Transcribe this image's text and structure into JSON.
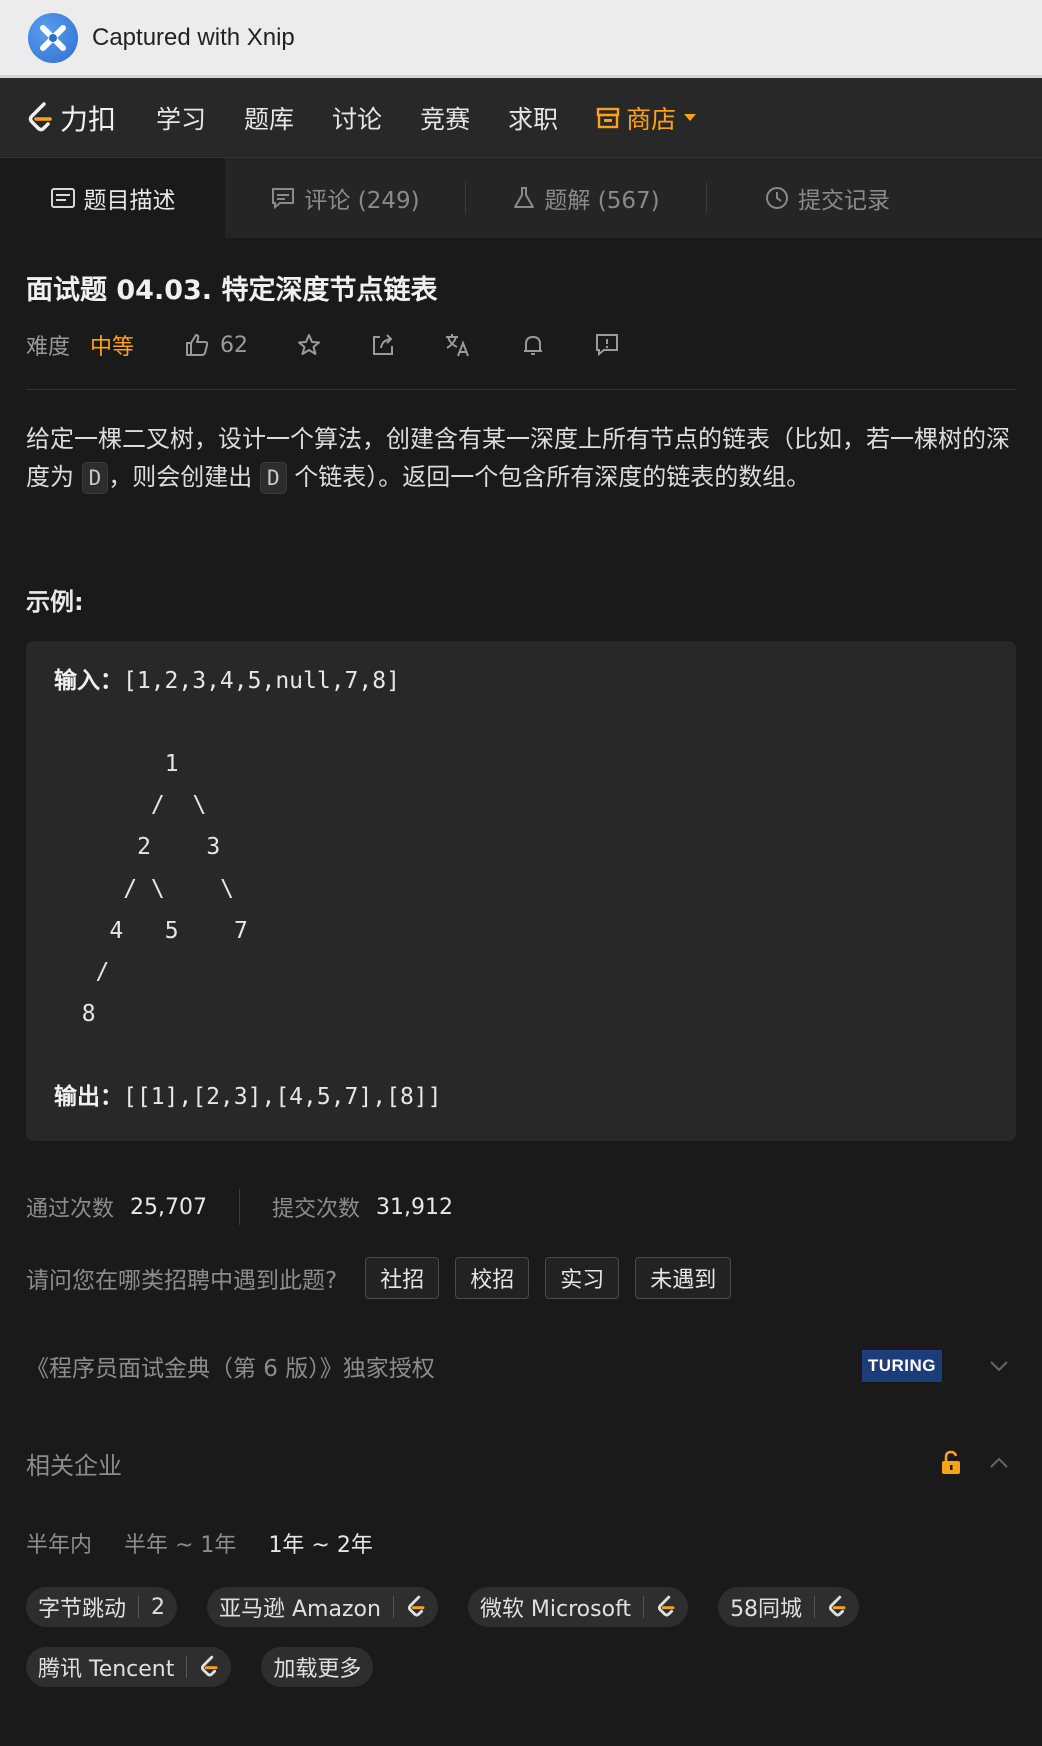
{
  "xnip": {
    "title": "Captured with Xnip"
  },
  "nav": {
    "brand": "力扣",
    "items": [
      "学习",
      "题库",
      "讨论",
      "竞赛",
      "求职"
    ],
    "store": "商店"
  },
  "tabs": {
    "description": "题目描述",
    "comments": "评论 (249)",
    "solutions": "题解 (567)",
    "submissions": "提交记录"
  },
  "problem": {
    "title": "面试题 04.03. 特定深度节点链表",
    "difficulty_label": "难度",
    "difficulty": "中等",
    "likes": "62",
    "desc_part1": "给定一棵二叉树，设计一个算法，创建含有某一深度上所有节点的链表（比如，若一棵树的深度为",
    "desc_code1": "D",
    "desc_part2": "，则会创建出",
    "desc_code2": "D",
    "desc_part3": "个链表）。返回一个包含所有深度的链表的数组。",
    "example_label": "示例:",
    "input_label": "输入：",
    "input_value": "[1,2,3,4,5,null,7,8]",
    "tree": "        1\n       /  \\\n      2    3\n     / \\    \\\n    4   5    7\n   /\n  8",
    "output_label": "输出：",
    "output_value": "[[1],[2,3],[4,5,7],[8]]"
  },
  "stats": {
    "accepted_label": "通过次数",
    "accepted": "25,707",
    "submitted_label": "提交次数",
    "submitted": "31,912"
  },
  "recruit": {
    "question": "请问您在哪类招聘中遇到此题?",
    "options": [
      "社招",
      "校招",
      "实习",
      "未遇到"
    ]
  },
  "authorization": {
    "text": "《程序员面试金典（第 6 版）》独家授权",
    "logo_text": "TURING"
  },
  "companies": {
    "title": "相关企业",
    "periods": [
      "半年内",
      "半年 ~ 1年",
      "1年 ~ 2年"
    ],
    "selected_period": "1年 ~ 2年",
    "tags": [
      {
        "name": "字节跳动",
        "count": "2"
      },
      {
        "name": "亚马逊 Amazon"
      },
      {
        "name": "微软 Microsoft"
      },
      {
        "name": "58同城"
      },
      {
        "name": "腾讯 Tencent"
      }
    ],
    "load_more": "加载更多"
  },
  "colors": {
    "accent": "#ffa116",
    "background": "#1a1a1a",
    "panel": "#282828"
  }
}
